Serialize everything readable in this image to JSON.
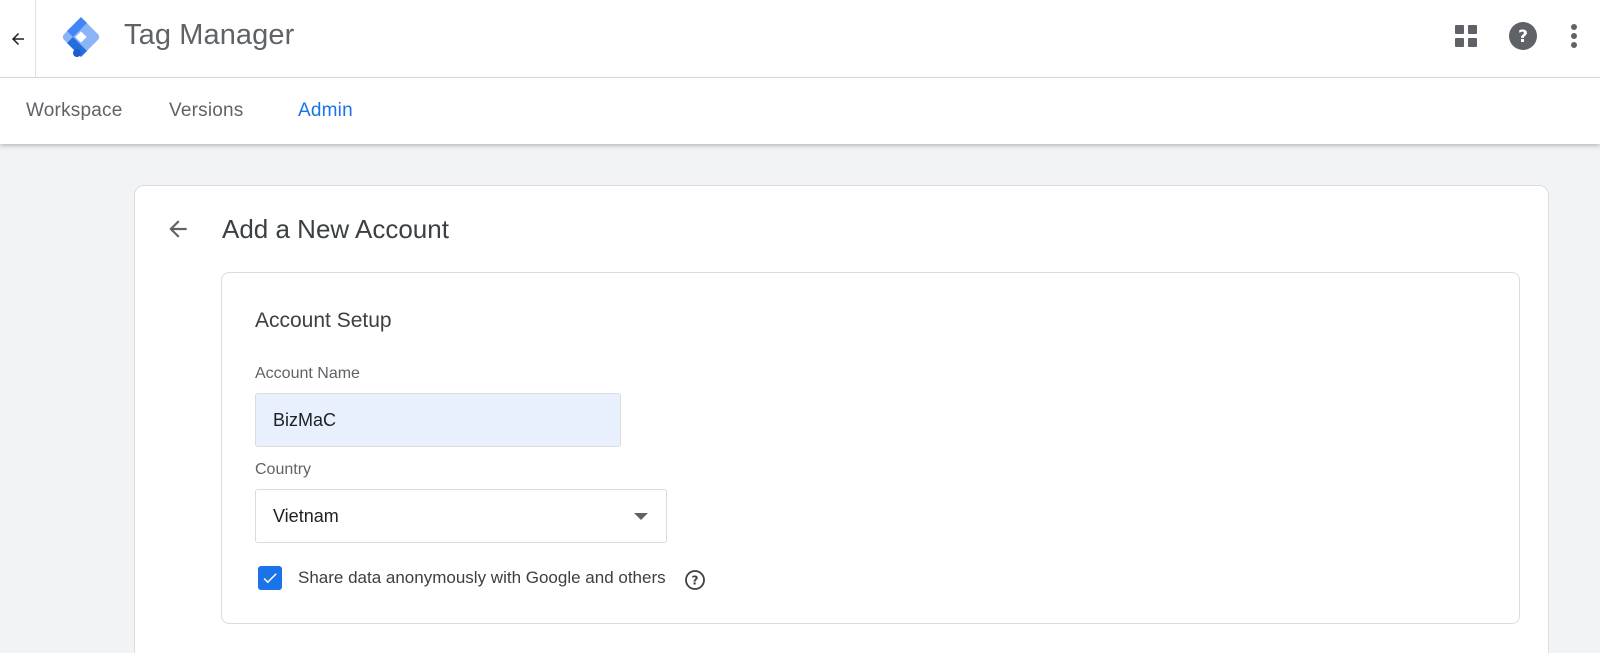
{
  "app": {
    "title": "Tag Manager",
    "brand_colors": {
      "dark_blue": "#246fdb",
      "light_blue": "#8ab4f8",
      "accent": "#1a73e8"
    }
  },
  "header": {
    "back_icon": "arrow-back-icon",
    "icons": [
      "apps-grid-icon",
      "help-icon",
      "more-vert-icon"
    ]
  },
  "tabs": [
    {
      "label": "Workspace",
      "active": false
    },
    {
      "label": "Versions",
      "active": false
    },
    {
      "label": "Admin",
      "active": true
    }
  ],
  "page": {
    "title": "Add a New Account",
    "back_icon": "arrow-back-icon"
  },
  "account_setup": {
    "section_title": "Account Setup",
    "account_name": {
      "label": "Account Name",
      "value": "BizMaC"
    },
    "country": {
      "label": "Country",
      "value": "Vietnam"
    },
    "share_data": {
      "checked": true,
      "label": "Share data anonymously with Google and others",
      "help_icon": "help-outline-icon"
    }
  }
}
